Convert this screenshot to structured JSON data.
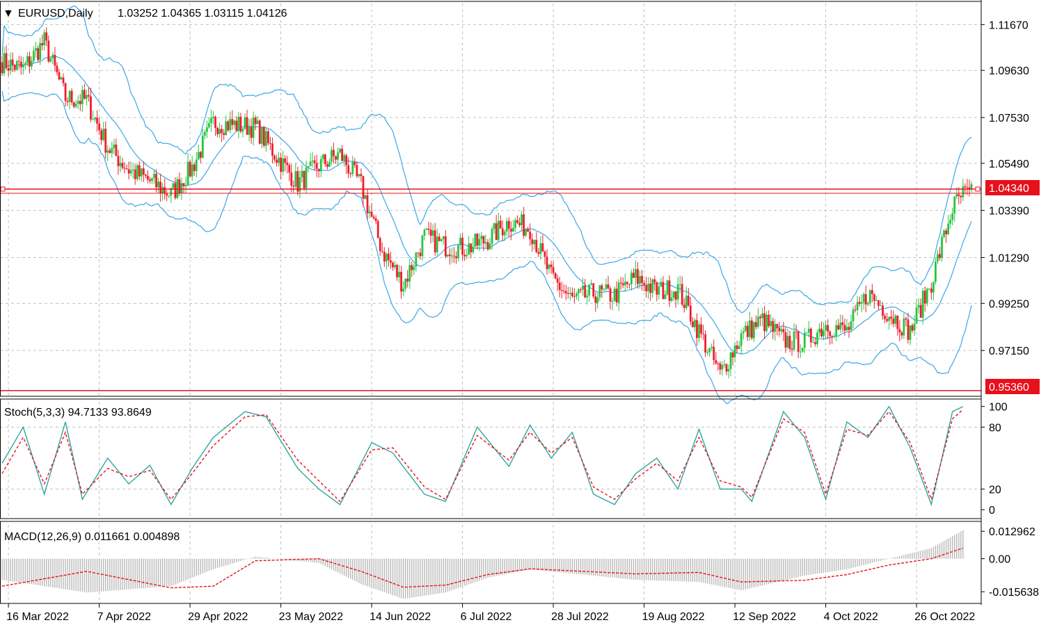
{
  "header": {
    "symbol_label": "EURUSD,Daily",
    "ohlc_label": "1.03252 1.04365 1.03115 1.04126"
  },
  "stoch": {
    "label": "Stoch(5,3,3) 94.7133 93.8649"
  },
  "macd": {
    "label": "MACD(12,26,9) 0.011661 0.004898"
  },
  "price_tags": {
    "upper": "1.04340",
    "lower": "0.95360"
  },
  "colors": {
    "bull": "#26c43f",
    "bear": "#ef1c2c",
    "bands": "#3aa6e8",
    "level_line": "#e8101c",
    "stoch_main": "#2fa5a0",
    "stoch_signal": "#e8101c",
    "histogram": "#b8b8b8",
    "macd_signal": "#e8101c",
    "grid": "#c0c0c0"
  },
  "chart_data": [
    {
      "type": "candlestick",
      "title": "EURUSD,Daily",
      "ylim": [
        0.9511,
        1.1261
      ],
      "y_ticks": [
        "1.11670",
        "1.09630",
        "1.07530",
        "1.05490",
        "1.03390",
        "1.01290",
        "0.99250",
        "0.97150"
      ],
      "x_ticks": [
        "16 Mar 2022",
        "7 Apr 2022",
        "29 Apr 2022",
        "23 May 2022",
        "14 Jun 2022",
        "6 Jul 2022",
        "28 Jul 2022",
        "19 Aug 2022",
        "12 Sep 2022",
        "4 Oct 2022",
        "26 Oct 2022"
      ],
      "levels": [
        1.0434,
        0.9536
      ],
      "series": [
        {
          "x": 0,
          "y": 1.1
        },
        {
          "x": 10,
          "y": 1.097
        },
        {
          "x": 20,
          "y": 1.109
        },
        {
          "x": 30,
          "y": 1.084
        },
        {
          "x": 40,
          "y": 1.083
        },
        {
          "x": 50,
          "y": 1.062
        },
        {
          "x": 60,
          "y": 1.052
        },
        {
          "x": 70,
          "y": 1.047
        },
        {
          "x": 80,
          "y": 1.041
        },
        {
          "x": 90,
          "y": 1.053
        },
        {
          "x": 100,
          "y": 1.073
        },
        {
          "x": 110,
          "y": 1.072
        },
        {
          "x": 120,
          "y": 1.071
        },
        {
          "x": 130,
          "y": 1.058
        },
        {
          "x": 140,
          "y": 1.046
        },
        {
          "x": 150,
          "y": 1.054
        },
        {
          "x": 160,
          "y": 1.059
        },
        {
          "x": 170,
          "y": 1.045
        },
        {
          "x": 180,
          "y": 1.016
        },
        {
          "x": 190,
          "y": 1.001
        },
        {
          "x": 200,
          "y": 1.022
        },
        {
          "x": 210,
          "y": 1.018
        },
        {
          "x": 220,
          "y": 1.017
        },
        {
          "x": 230,
          "y": 1.021
        },
        {
          "x": 240,
          "y": 1.029
        },
        {
          "x": 250,
          "y": 1.026
        },
        {
          "x": 260,
          "y": 1.004
        },
        {
          "x": 270,
          "y": 0.994
        },
        {
          "x": 280,
          "y": 0.997
        },
        {
          "x": 290,
          "y": 0.996
        },
        {
          "x": 300,
          "y": 1.004
        },
        {
          "x": 310,
          "y": 0.998
        },
        {
          "x": 320,
          "y": 0.999
        },
        {
          "x": 330,
          "y": 0.98
        },
        {
          "x": 340,
          "y": 0.961
        },
        {
          "x": 350,
          "y": 0.978
        },
        {
          "x": 360,
          "y": 0.985
        },
        {
          "x": 370,
          "y": 0.976
        },
        {
          "x": 380,
          "y": 0.975
        },
        {
          "x": 390,
          "y": 0.983
        },
        {
          "x": 400,
          "y": 0.98
        },
        {
          "x": 410,
          "y": 0.997
        },
        {
          "x": 420,
          "y": 0.988
        },
        {
          "x": 430,
          "y": 0.98
        },
        {
          "x": 440,
          "y": 1.002
        },
        {
          "x": 450,
          "y": 1.035
        },
        {
          "x": 455,
          "y": 1.041
        }
      ]
    },
    {
      "type": "line",
      "title": "Stoch(5,3,3) 94.7133 93.8649",
      "ylim": [
        0,
        100
      ],
      "y_ticks": [
        "100",
        "80",
        "20",
        "0"
      ],
      "series": [
        {
          "name": "main",
          "points": [
            [
              0,
              45
            ],
            [
              10,
              80
            ],
            [
              20,
              15
            ],
            [
              30,
              85
            ],
            [
              38,
              10
            ],
            [
              50,
              50
            ],
            [
              60,
              25
            ],
            [
              70,
              43
            ],
            [
              80,
              5
            ],
            [
              90,
              40
            ],
            [
              100,
              70
            ],
            [
              115,
              95
            ],
            [
              125,
              90
            ],
            [
              140,
              40
            ],
            [
              150,
              20
            ],
            [
              160,
              5
            ],
            [
              175,
              65
            ],
            [
              185,
              55
            ],
            [
              200,
              15
            ],
            [
              210,
              8
            ],
            [
              225,
              80
            ],
            [
              240,
              42
            ],
            [
              250,
              82
            ],
            [
              260,
              50
            ],
            [
              270,
              75
            ],
            [
              280,
              15
            ],
            [
              290,
              5
            ],
            [
              300,
              35
            ],
            [
              310,
              50
            ],
            [
              320,
              20
            ],
            [
              330,
              78
            ],
            [
              340,
              20
            ],
            [
              350,
              20
            ],
            [
              355,
              8
            ],
            [
              370,
              95
            ],
            [
              380,
              70
            ],
            [
              390,
              10
            ],
            [
              400,
              85
            ],
            [
              410,
              70
            ],
            [
              420,
              100
            ],
            [
              430,
              60
            ],
            [
              440,
              5
            ],
            [
              450,
              95
            ],
            [
              455,
              100
            ]
          ]
        },
        {
          "name": "signal",
          "points": [
            [
              0,
              35
            ],
            [
              10,
              70
            ],
            [
              20,
              25
            ],
            [
              30,
              75
            ],
            [
              38,
              15
            ],
            [
              50,
              40
            ],
            [
              60,
              32
            ],
            [
              70,
              38
            ],
            [
              80,
              10
            ],
            [
              90,
              35
            ],
            [
              100,
              62
            ],
            [
              115,
              90
            ],
            [
              125,
              92
            ],
            [
              140,
              48
            ],
            [
              150,
              28
            ],
            [
              160,
              8
            ],
            [
              175,
              58
            ],
            [
              185,
              60
            ],
            [
              200,
              22
            ],
            [
              210,
              10
            ],
            [
              225,
              72
            ],
            [
              240,
              48
            ],
            [
              250,
              75
            ],
            [
              260,
              55
            ],
            [
              270,
              70
            ],
            [
              280,
              22
            ],
            [
              290,
              10
            ],
            [
              300,
              30
            ],
            [
              310,
              45
            ],
            [
              320,
              28
            ],
            [
              330,
              70
            ],
            [
              340,
              28
            ],
            [
              350,
              22
            ],
            [
              355,
              12
            ],
            [
              370,
              88
            ],
            [
              380,
              75
            ],
            [
              390,
              15
            ],
            [
              400,
              78
            ],
            [
              410,
              72
            ],
            [
              420,
              95
            ],
            [
              430,
              65
            ],
            [
              440,
              10
            ],
            [
              450,
              88
            ],
            [
              455,
              97
            ]
          ]
        }
      ]
    },
    {
      "type": "bar+line",
      "title": "MACD(12,26,9) 0.011661 0.004898",
      "ylim": [
        -0.0205,
        0.016
      ],
      "y_ticks": [
        "0.012962",
        "0.00",
        "-0.015638"
      ],
      "series": [
        {
          "name": "histogram",
          "points": [
            [
              0,
              -0.01
            ],
            [
              40,
              -0.016
            ],
            [
              80,
              -0.013
            ],
            [
              100,
              -0.005
            ],
            [
              120,
              0.001
            ],
            [
              150,
              -0.002
            ],
            [
              170,
              -0.012
            ],
            [
              190,
              -0.019
            ],
            [
              210,
              -0.016
            ],
            [
              230,
              -0.009
            ],
            [
              250,
              -0.005
            ],
            [
              280,
              -0.008
            ],
            [
              300,
              -0.01
            ],
            [
              330,
              -0.011
            ],
            [
              350,
              -0.015
            ],
            [
              380,
              -0.008
            ],
            [
              400,
              -0.005
            ],
            [
              420,
              0.0
            ],
            [
              440,
              0.005
            ],
            [
              455,
              0.0135
            ]
          ]
        },
        {
          "name": "signal",
          "points": [
            [
              0,
              -0.013
            ],
            [
              40,
              -0.006
            ],
            [
              80,
              -0.0138
            ],
            [
              100,
              -0.013
            ],
            [
              120,
              -0.001
            ],
            [
              150,
              0.0
            ],
            [
              170,
              -0.006
            ],
            [
              190,
              -0.0135
            ],
            [
              210,
              -0.0125
            ],
            [
              230,
              -0.0075
            ],
            [
              250,
              -0.0048
            ],
            [
              280,
              -0.0062
            ],
            [
              300,
              -0.0072
            ],
            [
              330,
              -0.0065
            ],
            [
              350,
              -0.011
            ],
            [
              380,
              -0.0102
            ],
            [
              400,
              -0.0075
            ],
            [
              420,
              -0.003
            ],
            [
              440,
              0.0
            ],
            [
              455,
              0.005
            ]
          ]
        }
      ]
    }
  ]
}
